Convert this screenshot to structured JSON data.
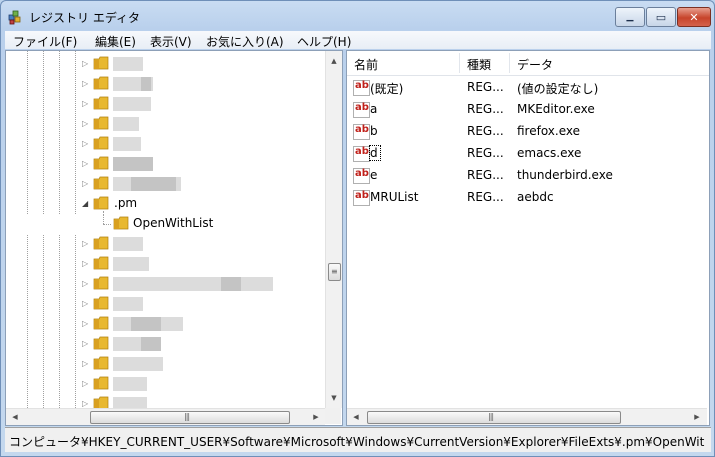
{
  "window": {
    "title": "レジストリ エディタ"
  },
  "titlebar": {
    "min_glyph": "▁",
    "max_glyph": "▭",
    "close_glyph": "✕"
  },
  "menu": [
    "ファイル(F)",
    "編集(E)",
    "表示(V)",
    "お気に入り(A)",
    "ヘルプ(H)"
  ],
  "tree": {
    "expanded_key": ".pm",
    "child_key": "OpenWithList",
    "expander_collapsed": "▷",
    "expander_expanded": "◢"
  },
  "scrollbar": {
    "up_arrow": "▲",
    "down_arrow": "▼",
    "left_arrow": "◀",
    "right_arrow": "▶",
    "v_grip": "≡",
    "h_grip": "|||"
  },
  "list": {
    "columns": {
      "name": "名前",
      "type": "種類",
      "data": "データ"
    },
    "icon_text": "ab",
    "rows": [
      {
        "name": "(既定)",
        "type": "REG...",
        "data": "(値の設定なし)"
      },
      {
        "name": "a",
        "type": "REG...",
        "data": "MKEditor.exe"
      },
      {
        "name": "b",
        "type": "REG...",
        "data": "firefox.exe"
      },
      {
        "name": "d",
        "type": "REG...",
        "data": "emacs.exe"
      },
      {
        "name": "e",
        "type": "REG...",
        "data": "thunderbird.exe"
      },
      {
        "name": "MRUList",
        "type": "REG...",
        "data": "aebdc"
      }
    ]
  },
  "status": {
    "path": "コンピュータ¥HKEY_CURRENT_USER¥Software¥Microsoft¥Windows¥CurrentVersion¥Explorer¥FileExts¥.pm¥OpenWit"
  },
  "colors": {
    "folder": "#e8b830",
    "ab_red": "#c0201a",
    "close": "#c7442b"
  }
}
